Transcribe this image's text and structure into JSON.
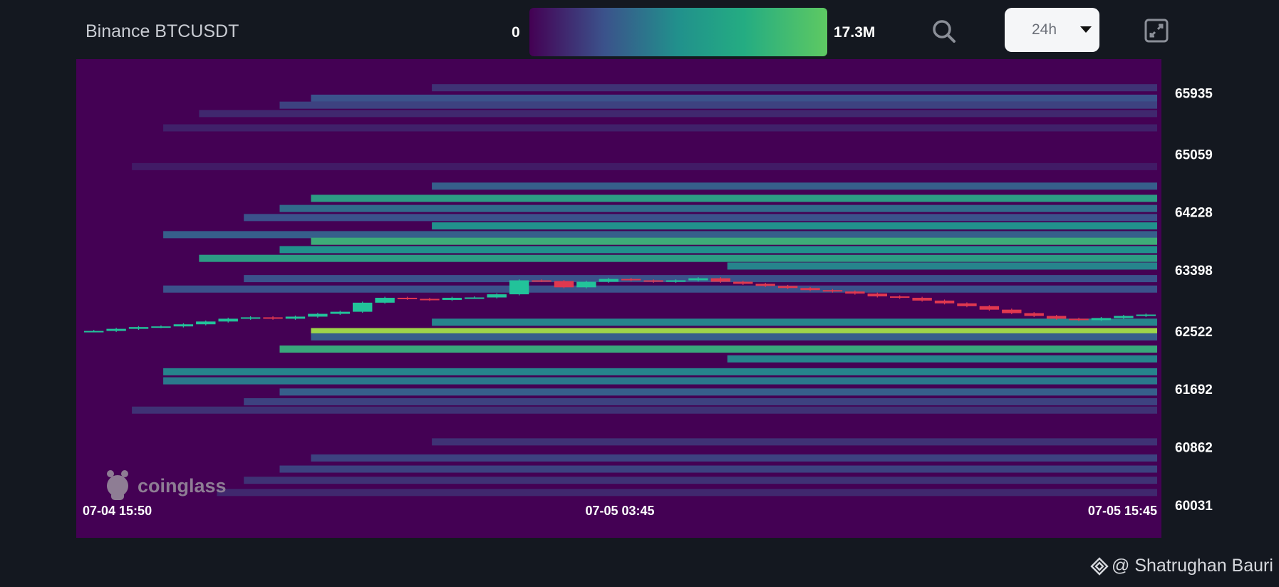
{
  "header": {
    "title": "Binance BTCUSDT",
    "scale_min_label": "0",
    "scale_max_label": "17.3M",
    "range_value": "24h"
  },
  "colors": {
    "background": "#141820",
    "plot_background": "#440154",
    "up_candle": "#22c39a",
    "down_candle": "#e0384f",
    "colorscale": [
      "#440154",
      "#3b528b",
      "#21918c",
      "#5ec962",
      "#fde725"
    ]
  },
  "icons": {
    "search": "search-icon",
    "dropdown": "chevron-down-icon",
    "fullscreen": "fullscreen-icon",
    "brand": "coinglass-logo",
    "binance": "binance-icon"
  },
  "watermark": "coinglass",
  "footer": {
    "credit": "@ Shatrughan Bauri"
  },
  "chart_data": {
    "type": "heatmap",
    "title": "Binance BTCUSDT",
    "x_ticks": [
      "07-04 15:50",
      "07-05 03:45",
      "07-05 15:45"
    ],
    "y_ticks": [
      65935,
      65059,
      64228,
      63398,
      62522,
      61692,
      60862,
      60031
    ],
    "ylim": [
      59560,
      66420
    ],
    "xlim": [
      0,
      24
    ],
    "color_range": [
      0,
      17.3
    ],
    "color_unit": "M",
    "liquidation_bands": [
      {
        "price": 66010,
        "start": 7.8,
        "level": 0.15
      },
      {
        "price": 65860,
        "start": 5.1,
        "level": 0.25
      },
      {
        "price": 65760,
        "start": 4.4,
        "level": 0.2
      },
      {
        "price": 65640,
        "start": 2.6,
        "level": 0.12
      },
      {
        "price": 65435,
        "start": 1.8,
        "level": 0.1
      },
      {
        "price": 64880,
        "start": 1.1,
        "level": 0.08
      },
      {
        "price": 64600,
        "start": 7.8,
        "level": 0.3
      },
      {
        "price": 64425,
        "start": 5.1,
        "level": 0.55
      },
      {
        "price": 64280,
        "start": 4.4,
        "level": 0.35
      },
      {
        "price": 64150,
        "start": 3.6,
        "level": 0.25
      },
      {
        "price": 64030,
        "start": 7.8,
        "level": 0.5
      },
      {
        "price": 63905,
        "start": 1.8,
        "level": 0.3
      },
      {
        "price": 63810,
        "start": 5.1,
        "level": 0.62
      },
      {
        "price": 63690,
        "start": 4.4,
        "level": 0.5
      },
      {
        "price": 63565,
        "start": 2.6,
        "level": 0.55
      },
      {
        "price": 63455,
        "start": 14.4,
        "level": 0.45
      },
      {
        "price": 63275,
        "start": 3.6,
        "level": 0.25
      },
      {
        "price": 63125,
        "start": 1.8,
        "level": 0.25
      },
      {
        "price": 62650,
        "start": 7.8,
        "level": 0.45
      },
      {
        "price": 62515,
        "start": 5.1,
        "level": 0.85
      },
      {
        "price": 62440,
        "start": 5.1,
        "level": 0.3
      },
      {
        "price": 62265,
        "start": 4.4,
        "level": 0.6
      },
      {
        "price": 62125,
        "start": 14.4,
        "level": 0.45
      },
      {
        "price": 61940,
        "start": 1.8,
        "level": 0.45
      },
      {
        "price": 61810,
        "start": 1.8,
        "level": 0.4
      },
      {
        "price": 61650,
        "start": 4.4,
        "level": 0.3
      },
      {
        "price": 61510,
        "start": 3.6,
        "level": 0.2
      },
      {
        "price": 61390,
        "start": 1.1,
        "level": 0.15
      },
      {
        "price": 60935,
        "start": 7.8,
        "level": 0.15
      },
      {
        "price": 60705,
        "start": 5.1,
        "level": 0.2
      },
      {
        "price": 60545,
        "start": 4.4,
        "level": 0.2
      },
      {
        "price": 60385,
        "start": 3.6,
        "level": 0.15
      },
      {
        "price": 60210,
        "start": 3.0,
        "level": 0.12
      }
    ],
    "price_series": [
      [
        0,
        62520
      ],
      [
        0.5,
        62525
      ],
      [
        1,
        62555
      ],
      [
        1.5,
        62580
      ],
      [
        2,
        62590
      ],
      [
        2.5,
        62620
      ],
      [
        3,
        62660
      ],
      [
        3.5,
        62700
      ],
      [
        4,
        62720
      ],
      [
        4.5,
        62700
      ],
      [
        5,
        62730
      ],
      [
        5.5,
        62770
      ],
      [
        6,
        62800
      ],
      [
        6.5,
        62930
      ],
      [
        7,
        63000
      ],
      [
        7.5,
        62985
      ],
      [
        8,
        62970
      ],
      [
        8.5,
        63000
      ],
      [
        9,
        63005
      ],
      [
        9.5,
        63050
      ],
      [
        10,
        63250
      ],
      [
        10.5,
        63240
      ],
      [
        11,
        63150
      ],
      [
        11.5,
        63230
      ],
      [
        12,
        63270
      ],
      [
        12.5,
        63250
      ],
      [
        13,
        63230
      ],
      [
        13.5,
        63250
      ],
      [
        14,
        63280
      ],
      [
        14.5,
        63230
      ],
      [
        15,
        63200
      ],
      [
        15.5,
        63170
      ],
      [
        16,
        63140
      ],
      [
        16.5,
        63110
      ],
      [
        17,
        63090
      ],
      [
        17.5,
        63060
      ],
      [
        18,
        63020
      ],
      [
        18.5,
        63000
      ],
      [
        19,
        62960
      ],
      [
        19.5,
        62920
      ],
      [
        20,
        62880
      ],
      [
        20.5,
        62830
      ],
      [
        21,
        62780
      ],
      [
        21.5,
        62740
      ],
      [
        22,
        62700
      ],
      [
        22.5,
        62680
      ],
      [
        23,
        62710
      ],
      [
        23.5,
        62740
      ],
      [
        24,
        62760
      ]
    ]
  }
}
